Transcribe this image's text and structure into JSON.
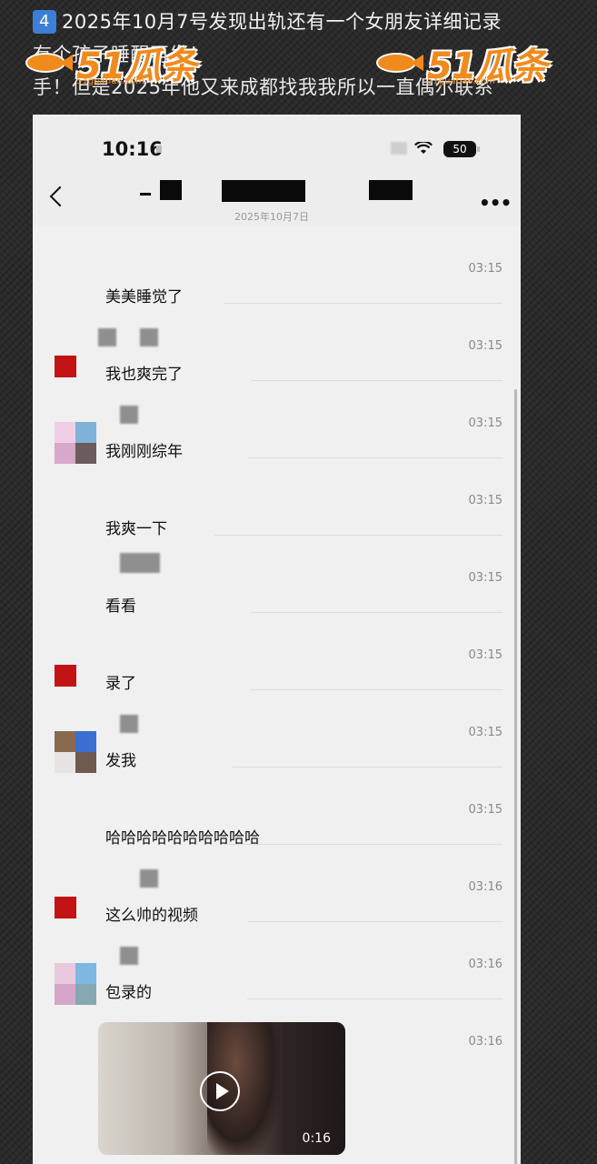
{
  "caption": {
    "badge": "4",
    "line1": "2025年10月7号发现出轨还有一个女朋友详细记录",
    "line2": "            有个孩子睡醒再发！        ",
    "line3": "手！但是2025年他又来成都找我我所以一直偶尔联系"
  },
  "watermark": {
    "text": "51瓜条",
    "url": "51guatiao.com"
  },
  "status": {
    "time": "10:16",
    "battery": "50"
  },
  "nav": {
    "date": "2025年10月7日"
  },
  "messages": [
    {
      "time": "03:15",
      "text": "美美睡觉了"
    },
    {
      "time": "03:15",
      "text": "我也爽完了"
    },
    {
      "time": "03:15",
      "text": "我刚刚综年"
    },
    {
      "time": "03:15",
      "text": "我爽一下"
    },
    {
      "time": "03:15",
      "text": "看看"
    },
    {
      "time": "03:15",
      "text": "录了"
    },
    {
      "time": "03:15",
      "text": "发我"
    },
    {
      "time": "03:15",
      "text": "哈哈哈哈哈哈哈哈哈哈"
    },
    {
      "time": "03:16",
      "text": "这么帅的视频"
    },
    {
      "time": "03:16",
      "text": "包录的"
    },
    {
      "time": "03:16",
      "text": ""
    }
  ],
  "video": {
    "duration": "0:16"
  },
  "colors": {
    "accent": "#f08a1d",
    "avatar_red": "#c21414"
  }
}
